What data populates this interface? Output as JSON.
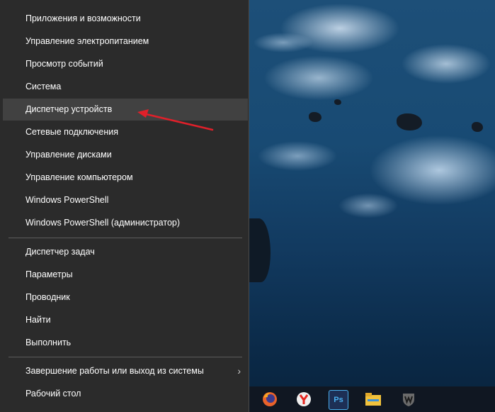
{
  "menu": {
    "group1": [
      {
        "label": "Приложения и возможности"
      },
      {
        "label": "Управление электропитанием"
      },
      {
        "label": "Просмотр событий"
      },
      {
        "label": "Система"
      },
      {
        "label": "Диспетчер устройств",
        "highlighted": true
      },
      {
        "label": "Сетевые подключения"
      },
      {
        "label": "Управление дисками"
      },
      {
        "label": "Управление компьютером"
      },
      {
        "label": "Windows PowerShell"
      },
      {
        "label": "Windows PowerShell (администратор)"
      }
    ],
    "group2": [
      {
        "label": "Диспетчер задач"
      },
      {
        "label": "Параметры"
      },
      {
        "label": "Проводник"
      },
      {
        "label": "Найти"
      },
      {
        "label": "Выполнить"
      }
    ],
    "group3": [
      {
        "label": "Завершение работы или выход из системы",
        "has_submenu": true
      },
      {
        "label": "Рабочий стол"
      }
    ],
    "submenu_chevron": "›"
  },
  "taskbar": {
    "icons": [
      {
        "name": "firefox-icon",
        "color": "#e8622b"
      },
      {
        "name": "yandex-browser-icon",
        "color": "#e9e9e9"
      },
      {
        "name": "photoshop-icon",
        "color": "#1d2f55",
        "text": "Ps"
      },
      {
        "name": "file-explorer-icon",
        "color": "#f1c23c"
      },
      {
        "name": "world-of-tanks-icon",
        "color": "#5a5a5a"
      }
    ]
  },
  "colors": {
    "menu_bg": "#2b2b2b",
    "menu_highlight": "#414141",
    "annotation_arrow": "#e0202a"
  }
}
